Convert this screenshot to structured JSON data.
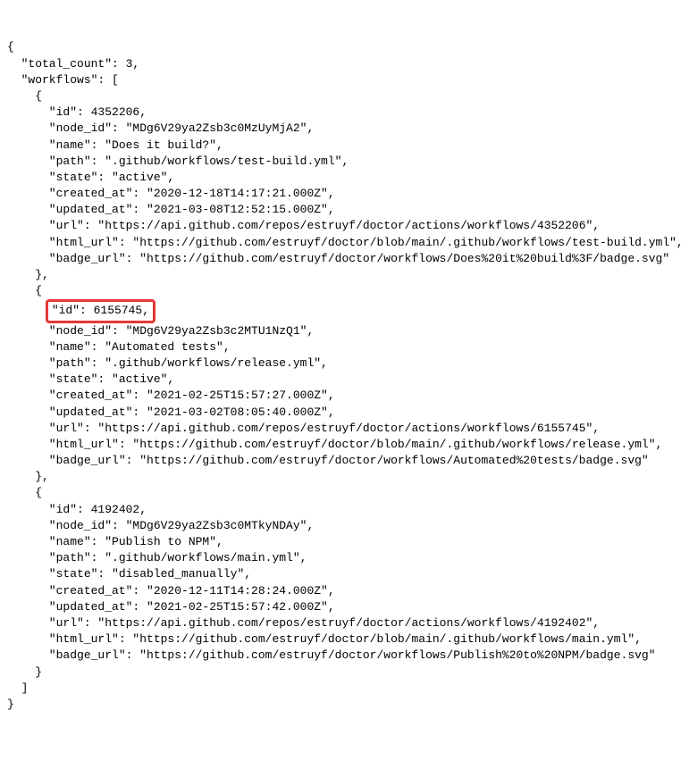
{
  "json": {
    "l00": "{",
    "l01": "  \"total_count\": 3,",
    "l02": "  \"workflows\": [",
    "l03": "    {",
    "l04": "      \"id\": 4352206,",
    "l05": "      \"node_id\": \"MDg6V29ya2Zsb3c0MzUyMjA2\",",
    "l06": "      \"name\": \"Does it build?\",",
    "l07": "      \"path\": \".github/workflows/test-build.yml\",",
    "l08": "      \"state\": \"active\",",
    "l09": "      \"created_at\": \"2020-12-18T14:17:21.000Z\",",
    "l10": "      \"updated_at\": \"2021-03-08T12:52:15.000Z\",",
    "l11": "      \"url\": \"https://api.github.com/repos/estruyf/doctor/actions/workflows/4352206\",",
    "l12": "      \"html_url\": \"https://github.com/estruyf/doctor/blob/main/.github/workflows/test-build.yml\",",
    "l13": "      \"badge_url\": \"https://github.com/estruyf/doctor/workflows/Does%20it%20build%3F/badge.svg\"",
    "l14": "    },",
    "l15": "    {",
    "hl_indent": "      ",
    "hl": "\"id\": 6155745,",
    "l17": "      \"node_id\": \"MDg6V29ya2Zsb3c2MTU1NzQ1\",",
    "l18": "      \"name\": \"Automated tests\",",
    "l19": "      \"path\": \".github/workflows/release.yml\",",
    "l20": "      \"state\": \"active\",",
    "l21": "      \"created_at\": \"2021-02-25T15:57:27.000Z\",",
    "l22": "      \"updated_at\": \"2021-03-02T08:05:40.000Z\",",
    "l23": "      \"url\": \"https://api.github.com/repos/estruyf/doctor/actions/workflows/6155745\",",
    "l24": "      \"html_url\": \"https://github.com/estruyf/doctor/blob/main/.github/workflows/release.yml\",",
    "l25": "      \"badge_url\": \"https://github.com/estruyf/doctor/workflows/Automated%20tests/badge.svg\"",
    "l26": "    },",
    "l27": "    {",
    "l28": "      \"id\": 4192402,",
    "l29": "      \"node_id\": \"MDg6V29ya2Zsb3c0MTkyNDAy\",",
    "l30": "      \"name\": \"Publish to NPM\",",
    "l31": "      \"path\": \".github/workflows/main.yml\",",
    "l32": "      \"state\": \"disabled_manually\",",
    "l33": "      \"created_at\": \"2020-12-11T14:28:24.000Z\",",
    "l34": "      \"updated_at\": \"2021-02-25T15:57:42.000Z\",",
    "l35": "      \"url\": \"https://api.github.com/repos/estruyf/doctor/actions/workflows/4192402\",",
    "l36": "      \"html_url\": \"https://github.com/estruyf/doctor/blob/main/.github/workflows/main.yml\",",
    "l37": "      \"badge_url\": \"https://github.com/estruyf/doctor/workflows/Publish%20to%20NPM/badge.svg\"",
    "l38": "    }",
    "l39": "  ]",
    "l40": "}"
  }
}
